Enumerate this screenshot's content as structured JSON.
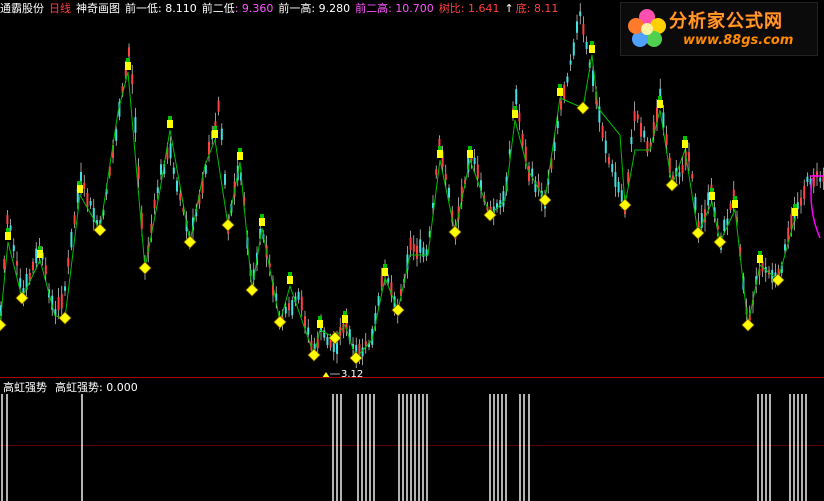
{
  "header": {
    "stock_name": "通霸股份",
    "period": "日线",
    "indicator": "神奇画图",
    "prev_low_label": "前一低",
    "prev_low_value": "8.110",
    "prev2_low_label": "前二低",
    "prev2_low_value": "9.360",
    "prev_high_label": "前一高",
    "prev_high_value": "9.280",
    "prev2_high_label": "前二高",
    "prev2_high_value": "10.700",
    "ratio_label": "树比",
    "ratio_value": "1.641",
    "bottom_label": "底",
    "bottom_value": "8.11"
  },
  "logo": {
    "title": "分析家公式网",
    "url": "www.88gs.com"
  },
  "main_chart": {
    "low_marker_label": "3.12",
    "colors": {
      "background": "#000000",
      "up_candle": "#ff4040",
      "down_candle": "#40e0e0",
      "wick": "#ffffff",
      "zigzag_line": "#00c000",
      "low_marker_fill": "#ffff00",
      "high_marker_fill": "#ffff00",
      "pivot_flag": "#00c000",
      "magenta": "#ff00ff",
      "divider": "#a00000"
    }
  },
  "sub_chart": {
    "panel_title": "高虹强势",
    "value_label": "高虹强势",
    "value": "0.000",
    "line_color": "#ffffff"
  }
}
